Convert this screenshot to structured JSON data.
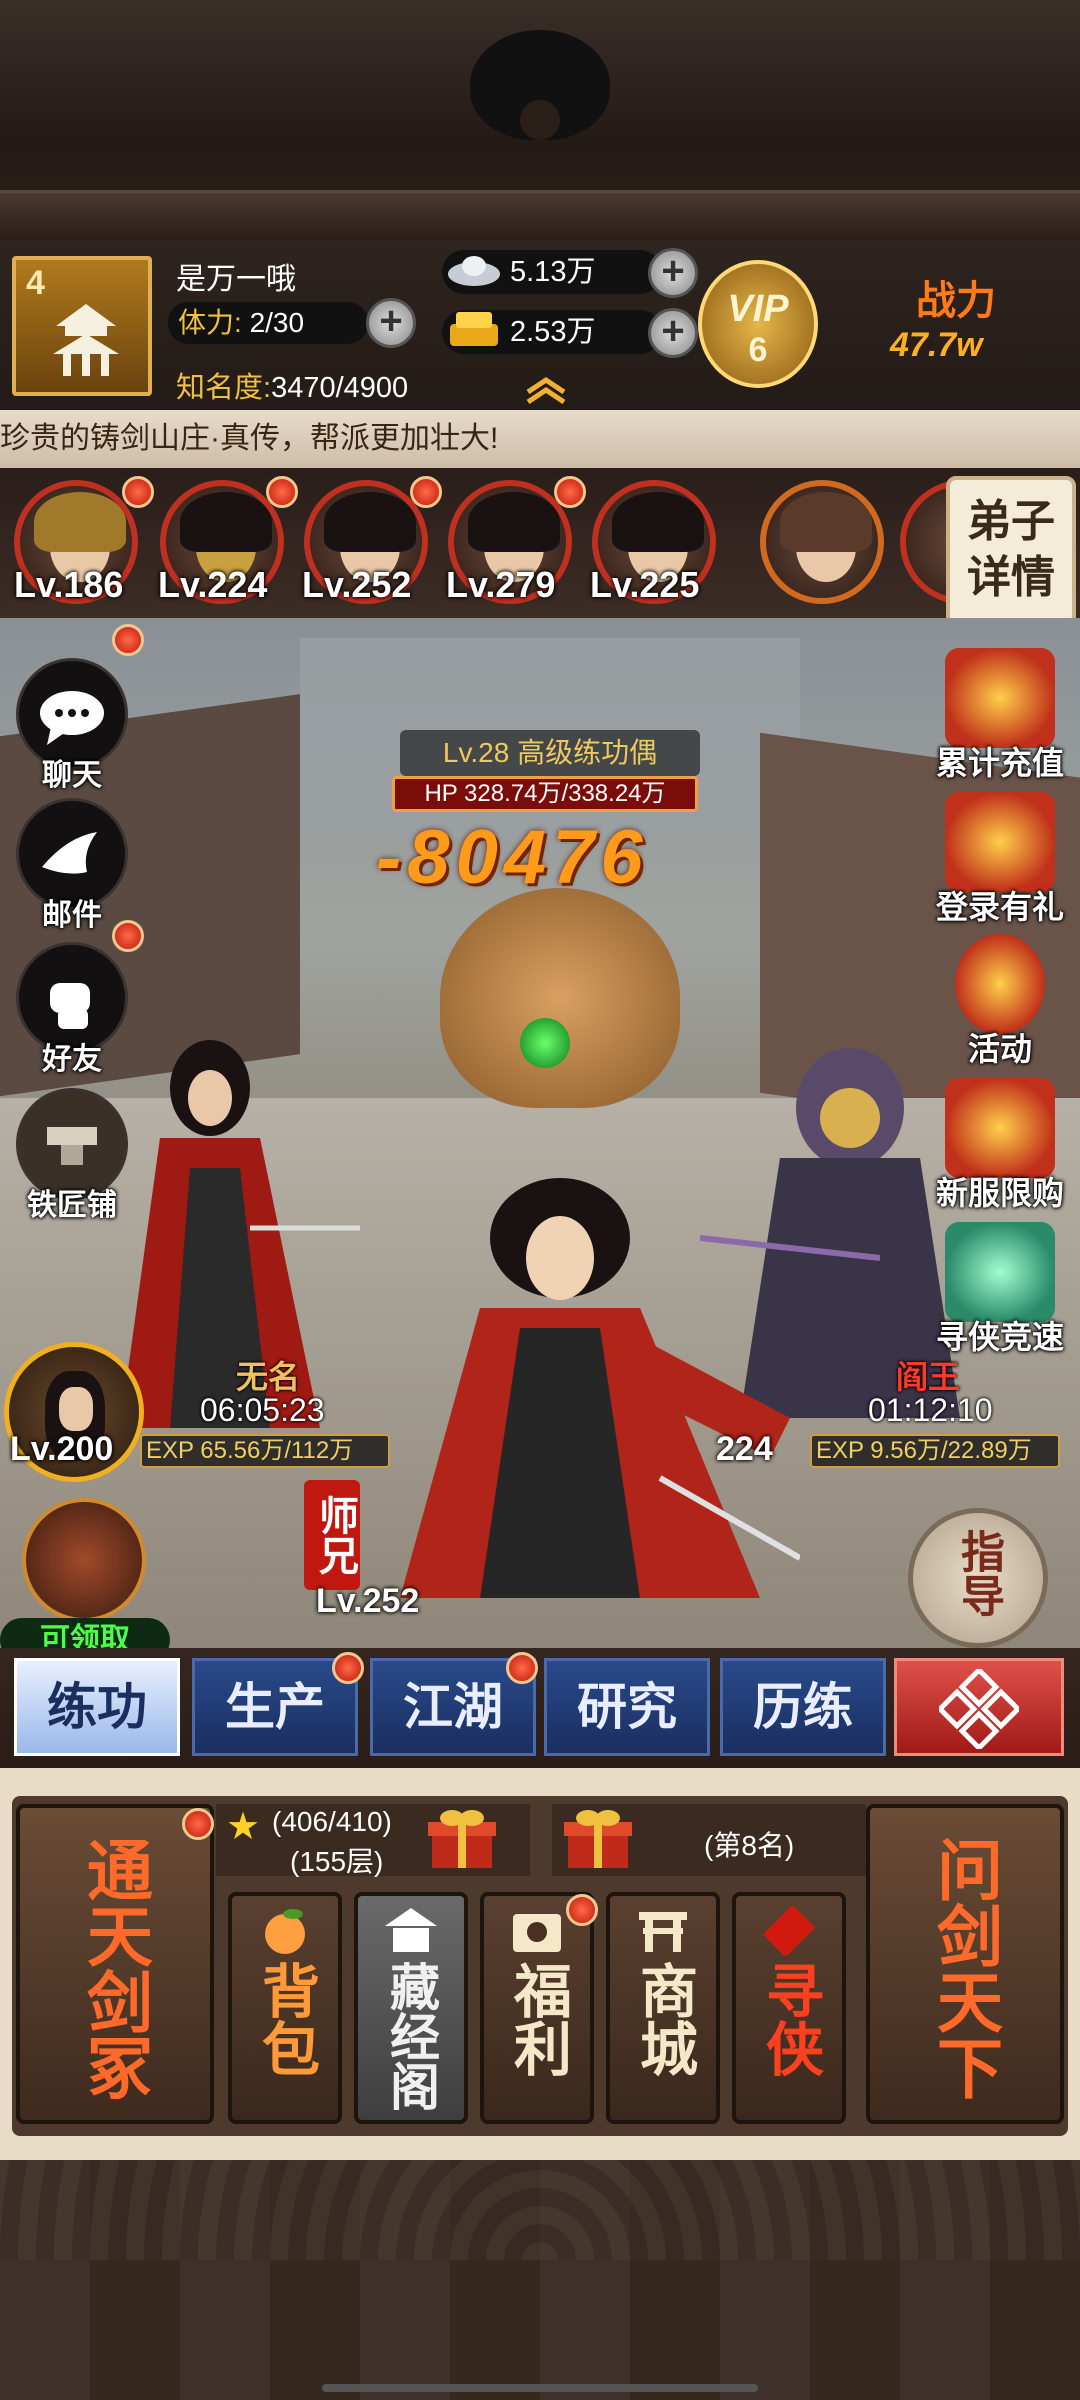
{
  "player": {
    "level": "4",
    "name": "是万一哦",
    "stamina_label": "体力:",
    "stamina_value": "2/30",
    "fame_label": "知名度:",
    "fame_value": "3470/4900"
  },
  "currencies": {
    "silver": "5.13万",
    "gold": "2.53万"
  },
  "vip": {
    "label": "VIP",
    "level": "6"
  },
  "power": {
    "label": "战力",
    "value": "47.7w"
  },
  "marquee": "珍贵的铸剑山庄·真传，帮派更加壮大!",
  "disciples": [
    {
      "level": "Lv.186"
    },
    {
      "level": "Lv.224"
    },
    {
      "level": "Lv.252"
    },
    {
      "level": "Lv.279"
    },
    {
      "level": "Lv.225"
    }
  ],
  "disciple_detail": "弟子详情",
  "side_left": [
    {
      "label": "聊天",
      "icon": "chat-bubble-icon"
    },
    {
      "label": "邮件",
      "icon": "dove-icon"
    },
    {
      "label": "好友",
      "icon": "fist-icon"
    },
    {
      "label": "铁匠铺",
      "icon": "anvil-icon"
    }
  ],
  "side_right": [
    {
      "label": "累计充值"
    },
    {
      "label": "登录有礼"
    },
    {
      "label": "活动"
    },
    {
      "label": "新服限购"
    },
    {
      "label": "寻侠竞速"
    }
  ],
  "enemy": {
    "title": "Lv.28 高级练功偶",
    "hp": "HP 328.74万/338.24万",
    "damage": "-80476"
  },
  "characters": {
    "left_name": "无名",
    "left_time": "06:05:23",
    "left_level": "Lv.200",
    "left_exp": "EXP 65.56万/112万",
    "right_name": "阎王",
    "right_time": "01:12:10",
    "right_level": "224",
    "right_exp": "EXP 9.56万/22.89万",
    "main_level": "Lv.252",
    "master_badge": "师兄"
  },
  "claim_label": "可领取",
  "guide_label": "指导",
  "tabs": [
    "练功",
    "生产",
    "江湖",
    "研究",
    "历练"
  ],
  "panel": {
    "left_card": "通天剑冢",
    "right_card": "问剑天下",
    "progress": "(406/410)",
    "floor": "(155层)",
    "rank": "(第8名)",
    "cards": [
      "背包",
      "藏经阁",
      "福利",
      "商城",
      "寻侠"
    ]
  },
  "colors": {
    "accent_red": "#c01808",
    "gold": "#f0c040",
    "tab_blue": "#1a2e60"
  }
}
